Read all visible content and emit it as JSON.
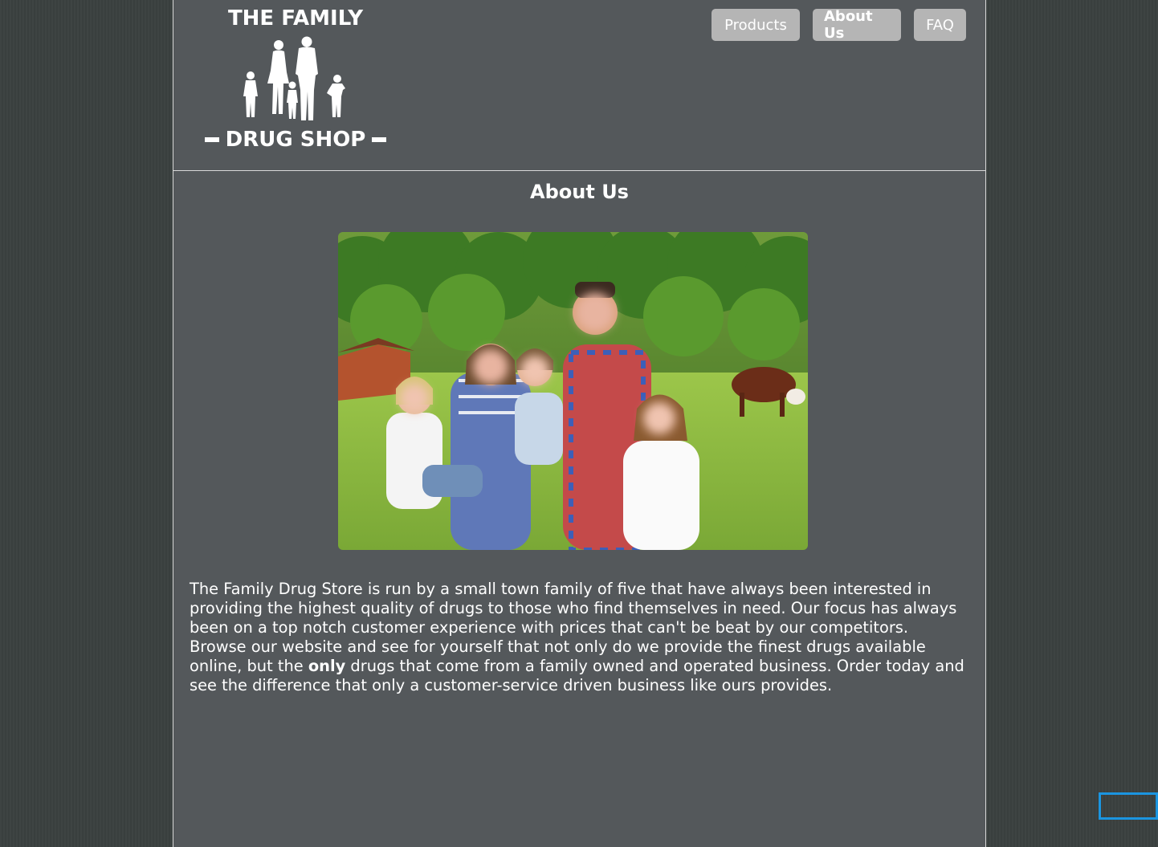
{
  "logo": {
    "top_text": "THE FAMILY",
    "bottom_text": "DRUG SHOP"
  },
  "nav": {
    "items": [
      {
        "label": "Products",
        "active": false
      },
      {
        "label": "About Us",
        "active": true
      },
      {
        "label": "FAQ",
        "active": false
      }
    ]
  },
  "main": {
    "title": "About Us",
    "paragraph": {
      "part1": "The Family Drug Store is run by a small town family of five that have always been interested in providing the highest quality of drugs to those who find themselves in need. Our focus has always been on a top notch customer experience with prices that can't be beat by our competitors. Browse our website and see for yourself that not only do we provide the finest drugs available online, but the ",
      "emphasis": "only",
      "part2": " drugs that come from a family owned and operated business. Order today and see the difference that only a customer-service driven business like ours provides."
    }
  },
  "colors": {
    "background": "#3a403f",
    "page": "#54585b",
    "nav_button": "#b5b5b5",
    "focus_outline": "#1b95e0"
  }
}
